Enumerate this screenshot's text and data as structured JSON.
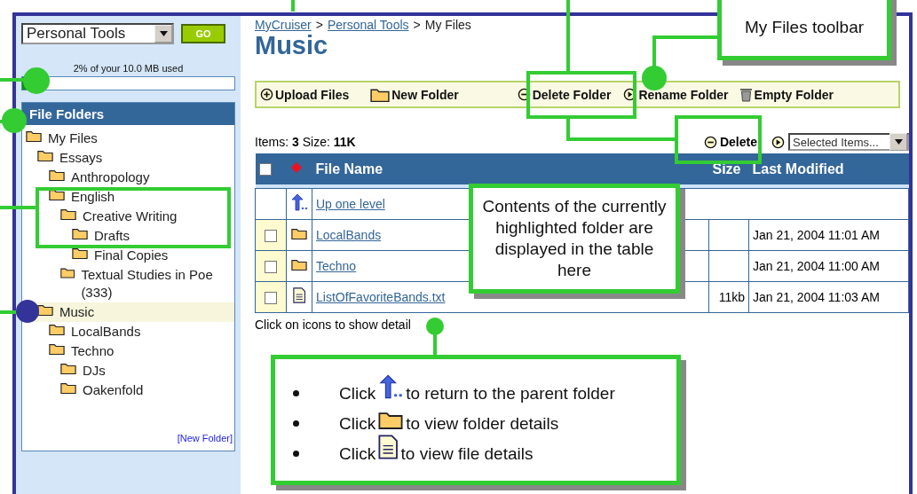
{
  "nav": {
    "dropdown": "Personal Tools",
    "go": "GO"
  },
  "quota": {
    "text": "2% of your 10.0 MB used",
    "level": 0.02
  },
  "folders": {
    "title": "File Folders",
    "new_folder": "[New Folder]",
    "tree": [
      {
        "label": "My Files",
        "selected": false,
        "children": [
          {
            "label": "Essays",
            "selected": false,
            "children": [
              {
                "label": "Anthropology",
                "selected": false
              },
              {
                "label": "English",
                "selected": false,
                "children": [
                  {
                    "label": "Creative Writing",
                    "selected": false,
                    "children": [
                      {
                        "label": "Drafts",
                        "selected": false
                      },
                      {
                        "label": "Final Copies",
                        "selected": false
                      }
                    ]
                  },
                  {
                    "label": "Textual Studies in Poe (333)",
                    "selected": false
                  }
                ]
              }
            ]
          },
          {
            "label": "Music",
            "selected": true,
            "children": [
              {
                "label": "LocalBands",
                "selected": false
              },
              {
                "label": "Techno",
                "selected": false,
                "children": [
                  {
                    "label": "DJs",
                    "selected": false
                  },
                  {
                    "label": "Oakenfold",
                    "selected": false
                  }
                ]
              }
            ]
          }
        ]
      }
    ]
  },
  "breadcrumb": [
    {
      "kind": "link",
      "label": "MyCruiser"
    },
    {
      "kind": "sep",
      "label": ">"
    },
    {
      "kind": "link",
      "label": "Personal Tools"
    },
    {
      "kind": "sep",
      "label": ">"
    },
    {
      "kind": "current",
      "label": "My Files"
    }
  ],
  "title": "Music",
  "toolbar": [
    {
      "kind": "plus",
      "label": "Upload Files"
    },
    {
      "kind": "folder",
      "label": "New Folder"
    },
    {
      "kind": "minus",
      "label": "Delete Folder"
    },
    {
      "kind": "play",
      "label": "Rename Folder"
    },
    {
      "kind": "trash",
      "label": "Empty Folder"
    }
  ],
  "summary": "Items: **3** Size: **11K**",
  "delete": "Delete",
  "action_select": "Selected Items...",
  "table": {
    "header_checked": false,
    "columns": [
      "File Name",
      "Size",
      "Last Modified"
    ],
    "rows": [
      {
        "kind": "up",
        "name": "Up one level"
      },
      {
        "kind": "folder",
        "name": "LocalBands",
        "checked": false,
        "modified": "Jan 21, 2004 11:01 AM"
      },
      {
        "kind": "folder",
        "name": "Techno",
        "checked": false,
        "modified": "Jan 21, 2004 11:00 AM"
      },
      {
        "kind": "file",
        "name": "ListOfFavoriteBands.txt",
        "checked": false,
        "size": "11kb",
        "modified": "Jan 21, 2004 11:03 AM"
      }
    ]
  },
  "hint": "Click on icons to show detail",
  "callouts": [
    {
      "kind": "toolbar",
      "text": "My Files toolbar"
    },
    {
      "kind": "table",
      "text": "Contents of the currently highlighted folder are displayed in the table here"
    },
    {
      "kind": "list",
      "items": [
        {
          "kind": "up",
          "before": "Click",
          "after": "to return to the parent folder"
        },
        {
          "kind": "folder",
          "before": "Click",
          "after": "to view folder details"
        },
        {
          "kind": "file",
          "before": "Click",
          "after": "to view file details"
        }
      ]
    }
  ]
}
